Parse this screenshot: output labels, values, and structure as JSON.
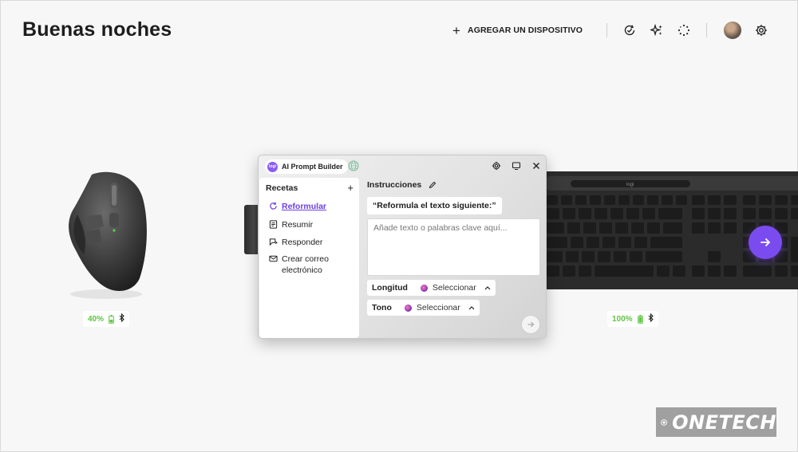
{
  "header": {
    "greeting": "Buenas noches",
    "add_device_label": "AGREGAR UN DISPOSITIVO",
    "icons": [
      "plus-icon",
      "refresh-check-icon",
      "sparkle-icon",
      "loading-dots-icon",
      "avatar",
      "gear-icon"
    ]
  },
  "devices": {
    "mouse": {
      "battery": "40%",
      "battery_level": 0.4,
      "connection": "bluetooth"
    },
    "keyboard": {
      "battery": "100%",
      "battery_level": 1.0,
      "connection": "bluetooth",
      "logo": "logi"
    }
  },
  "popup": {
    "title": "AI Prompt Builder",
    "badge": "logi",
    "recipes_title": "Recetas",
    "recipes": [
      {
        "label": "Reformular",
        "icon": "rephrase-icon",
        "active": true
      },
      {
        "label": "Resumir",
        "icon": "summary-icon",
        "active": false
      },
      {
        "label": "Responder",
        "icon": "reply-icon",
        "active": false
      },
      {
        "label": "Crear correo electrónico",
        "icon": "email-icon",
        "active": false
      }
    ],
    "instructions_title": "Instrucciones",
    "instruction_chip": "“Reformula el texto siguiente:”",
    "text_placeholder": "Añade texto o palabras clave aquí...",
    "text_value": "",
    "length": {
      "label": "Longitud",
      "value": "Seleccionar"
    },
    "tone": {
      "label": "Tono",
      "value": "Seleccionar"
    }
  },
  "watermark": {
    "text": "ONETECH"
  },
  "colors": {
    "accent": "#7a4cf0",
    "battery_green": "#5fc545",
    "background": "#f7f7f7"
  }
}
